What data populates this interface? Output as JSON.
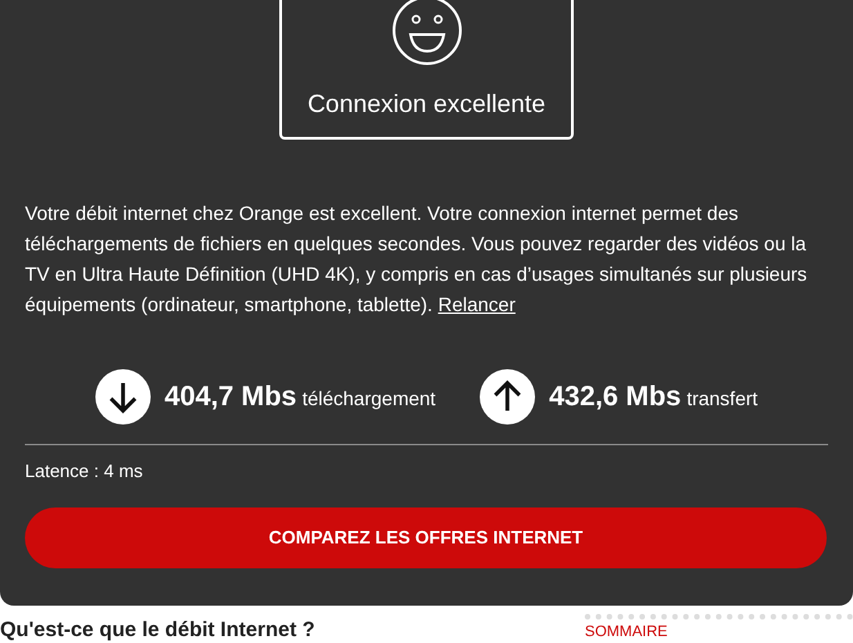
{
  "status_box": {
    "label": "Connexion excellente"
  },
  "description": {
    "text": "Votre débit internet chez Orange est excellent. Votre connexion internet permet des téléchargements de fichiers en quelques secondes. Vous pouvez regarder des vidéos ou la TV en Ultra Haute Définition (UHD 4K), y compris en cas d’usages simultanés sur plusieurs équipements (ordinateur, smartphone, tablette).",
    "link": "Relancer"
  },
  "speeds": [
    {
      "kind": "download",
      "value": "404,7 Mbs",
      "label": "téléchargement"
    },
    {
      "kind": "upload",
      "value": "432,6 Mbs",
      "label": "transfert"
    }
  ],
  "latency": "Latence : 4 ms",
  "cta_button": "COMPAREZ LES OFFRES INTERNET",
  "article_heading": "Qu'est-ce que le débit Internet ?",
  "sidebar_heading": "SOMMAIRE"
}
